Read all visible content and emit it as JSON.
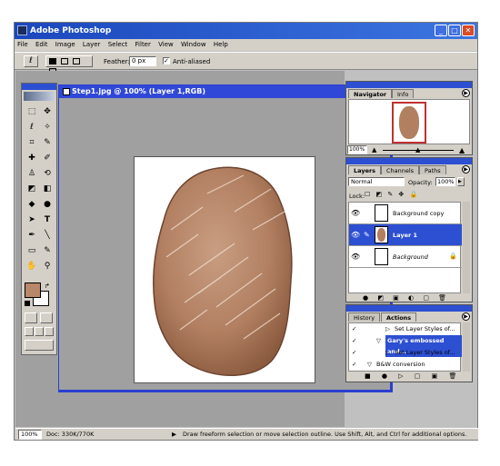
{
  "app": {
    "title": "Adobe Photoshop"
  },
  "menu": [
    "File",
    "Edit",
    "Image",
    "Layer",
    "Select",
    "Filter",
    "View",
    "Window",
    "Help"
  ],
  "options": {
    "feather_label": "Feather:",
    "feather_value": "0 px",
    "antialias_label": "Anti-aliased",
    "antialias_checked": true
  },
  "document": {
    "title": "Step1.jpg @ 100% (Layer 1,RGB)"
  },
  "navigator": {
    "tabs": [
      "Navigator",
      "Info"
    ],
    "zoom": "100%"
  },
  "layers": {
    "tabs": [
      "Layers",
      "Channels",
      "Paths"
    ],
    "blend_mode": "Normal",
    "opacity_label": "Opacity:",
    "opacity_value": "100%",
    "lock_label": "Lock:",
    "items": [
      {
        "name": "Background copy",
        "selected": false
      },
      {
        "name": "Layer 1",
        "selected": true
      },
      {
        "name": "Background",
        "selected": false
      }
    ]
  },
  "actions": {
    "tabs": [
      "History",
      "Actions"
    ],
    "items": [
      {
        "label": "Set Layer Styles of...",
        "selected": false
      },
      {
        "label": "Gary's embossed and...",
        "selected": true
      },
      {
        "label": "Set Layer Styles of...",
        "selected": false
      },
      {
        "label": "B&W conversion",
        "selected": false
      }
    ]
  },
  "status": {
    "zoom": "100%",
    "doc": "Doc: 330K/770K",
    "hint": "Draw freeform selection or move selection outline.  Use Shift, Alt, and Ctrl for additional options."
  },
  "colors": {
    "titlebar": "#1b47bd",
    "panel_header": "#2d4fd1",
    "foreground": "#b9876a",
    "background": "#ffffff"
  }
}
